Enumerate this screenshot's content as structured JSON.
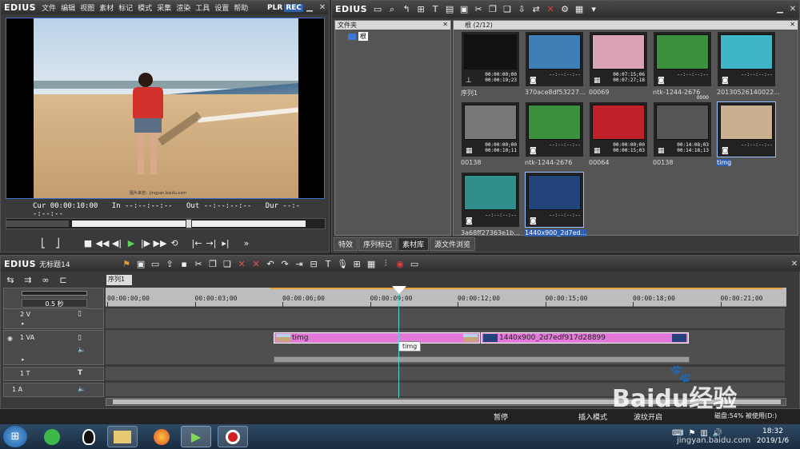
{
  "player": {
    "brand": "EDIUS",
    "menu": [
      "文件",
      "编辑",
      "视图",
      "素材",
      "标记",
      "模式",
      "采集",
      "渲染",
      "工具",
      "设置",
      "帮助"
    ],
    "plr": "PLR",
    "rec": "REC",
    "timecodes": {
      "cur_label": "Cur",
      "cur": "00:00:10:00",
      "in_label": "In",
      "in": "--:--:--:--",
      "out_label": "Out",
      "out": "--:--:--:--",
      "dur_label": "Dur",
      "dur": "--:--:--:--"
    },
    "watermark": "图片来自：jingyan.baidu.com"
  },
  "bin": {
    "brand": "EDIUS",
    "folder_panel_title": "文件夹",
    "folder_root": "根",
    "clip_panel_title": "根 (2/12)",
    "tabs": [
      "特效",
      "序列标记",
      "素材库",
      "源文件浏览"
    ],
    "active_tab": 2,
    "items": [
      {
        "label": "序列1",
        "tc1": "00:00:00;00",
        "tc2": "00:00:19;23",
        "color": "#111111",
        "icon": "sequence-icon"
      },
      {
        "label": "370ace8df53227...",
        "tc1": "--:--:--:--",
        "tc2": "",
        "color": "#3f7fb8",
        "icon": "camera-icon"
      },
      {
        "label": "00069",
        "tc1": "00:07:15;06",
        "tc2": "00:07:27;18",
        "color": "#d9a3b5",
        "icon": "film-icon"
      },
      {
        "label": "ntk-1244-2676",
        "tc1": "--:--:--:--",
        "tc2": "",
        "color": "#3c8f3c",
        "icon": "camera-icon"
      },
      {
        "label": "20130526140022...",
        "tc1": "--:--:--:--",
        "tc2": "",
        "color": "#3fb5c8",
        "icon": "camera-icon"
      },
      {
        "label": "00138",
        "tc1": "00:00:00;00",
        "tc2": "00:00:10;11",
        "color": "#777777",
        "icon": "film-icon"
      },
      {
        "label": "ntk-1244-2676",
        "tc1": "--:--:--:--",
        "tc2": "",
        "color": "#3c8f3c",
        "icon": "camera-icon"
      },
      {
        "label": "00064",
        "tc1": "00:00:00;00",
        "tc2": "00:00:15;03",
        "color": "#c0202a",
        "icon": "film-icon"
      },
      {
        "label": "00138",
        "tc1": "00:14:08;03",
        "tc2": "00:14:18;13",
        "color": "#555555",
        "icon": "film-icon",
        "badge": "0000"
      },
      {
        "label": "timg",
        "tc1": "--:--:--:--",
        "tc2": "",
        "color": "#c8b090",
        "icon": "camera-icon",
        "selected": true
      },
      {
        "label": "3a68ff27363e1b...",
        "tc1": "--:--:--:--",
        "tc2": "",
        "color": "#2f8f8a",
        "icon": "camera-icon"
      },
      {
        "label": "1440x900_2d7ed...",
        "tc1": "--:--:--:--",
        "tc2": "",
        "color": "#22447a",
        "icon": "camera-icon",
        "selected": true
      }
    ]
  },
  "timeline": {
    "brand": "EDIUS",
    "project": "无标题14",
    "sequence_tab": "序列1",
    "zoom": "0.5 秒",
    "ruler": [
      "00:00:00;00",
      "00:00:03;00",
      "00:00:06;00",
      "00:00:09;00",
      "00:00:12;00",
      "00:00:15;00",
      "00:00:18;00",
      "00:00:21;00"
    ],
    "tracks": {
      "v2": "2 V",
      "va1": "1 VA",
      "t1": "1 T",
      "a1": "1 A"
    },
    "clips": {
      "clip1": "timg",
      "clip2": "1440x900_2d7edf917d28899",
      "tooltip": "timg"
    }
  },
  "status": {
    "pause": "暂停",
    "insert_mode": "插入模式",
    "ripple": "波纹开启",
    "disk": "磁盘:54% 被使用(D:)"
  },
  "taskbar": {
    "time": "18:32",
    "date": "2019/1/6",
    "watermark": "Baidu经验",
    "watermark_url": "jingyan.baidu.com"
  }
}
